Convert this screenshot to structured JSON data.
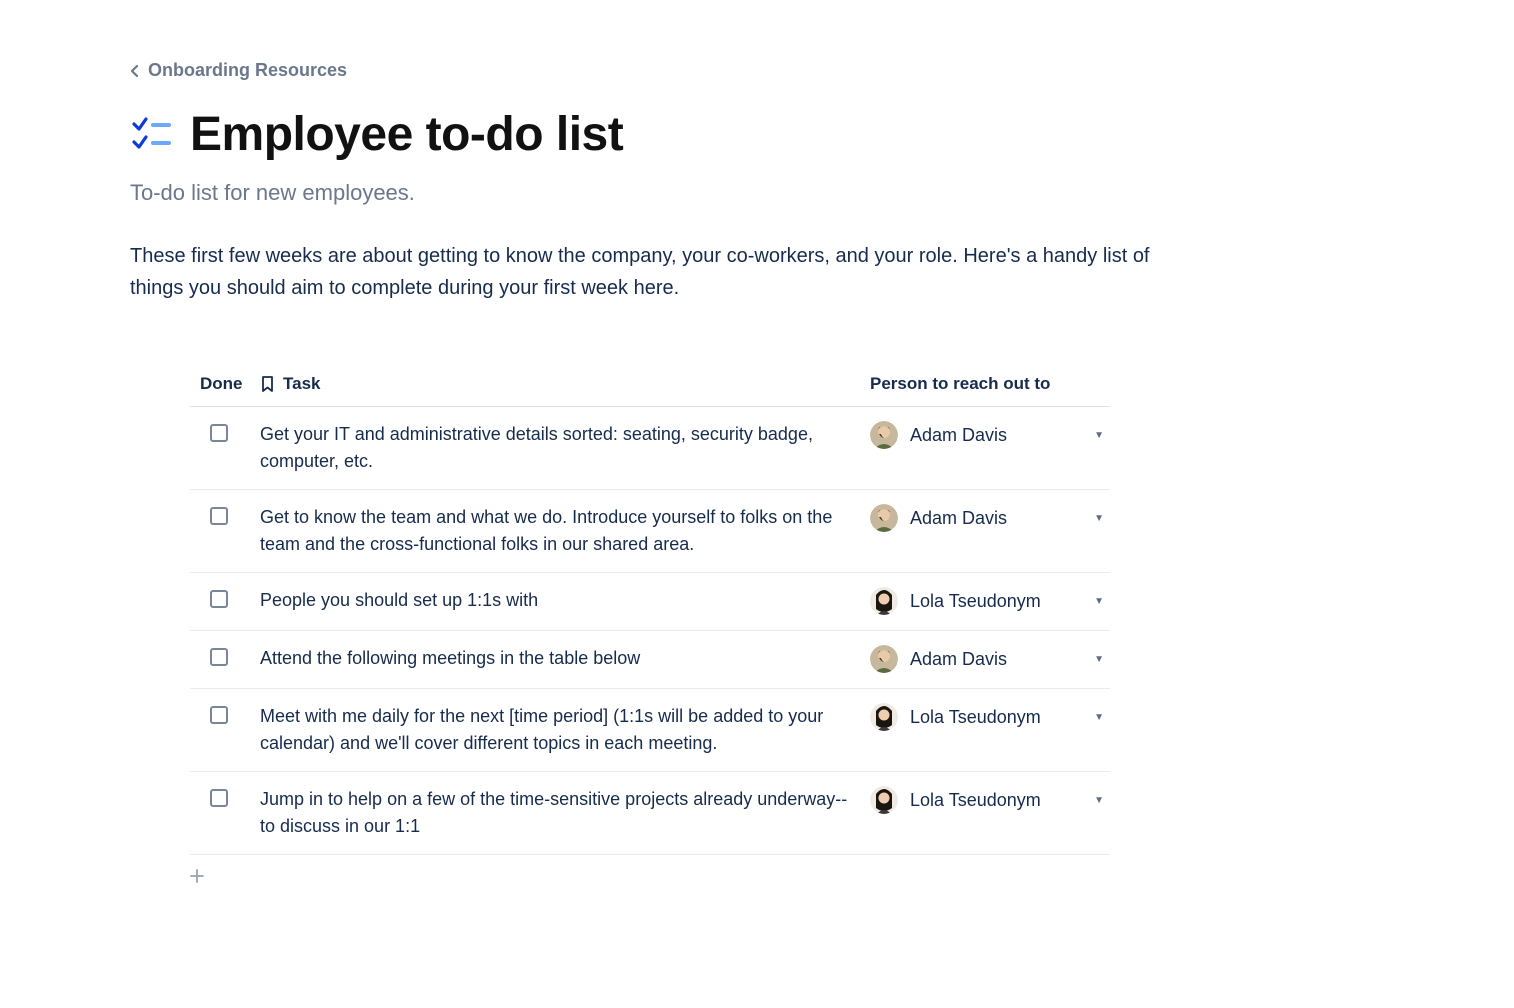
{
  "breadcrumb": {
    "label": "Onboarding Resources"
  },
  "title": "Employee to-do list",
  "subtitle": "To-do list for new employees.",
  "intro": "These first few weeks are about getting to know the company, your co-workers, and your role. Here's a handy list of things you should aim to complete during your first week here.",
  "table": {
    "headers": {
      "done": "Done",
      "task": "Task",
      "person": "Person to reach out to"
    },
    "rows": [
      {
        "done": false,
        "task": "Get your IT and administrative details sorted: seating, security badge, computer, etc.",
        "person": "Adam Davis",
        "avatar": "adam"
      },
      {
        "done": false,
        "task": "Get to know the team and what we do. Introduce yourself to folks on the team and the cross-functional folks in our shared area.",
        "person": "Adam Davis",
        "avatar": "adam"
      },
      {
        "done": false,
        "task": "People you should set up 1:1s with",
        "person": "Lola Tseudonym",
        "avatar": "lola"
      },
      {
        "done": false,
        "task": "Attend the following meetings in the table below",
        "person": "Adam Davis",
        "avatar": "adam"
      },
      {
        "done": false,
        "task": "Meet with me daily for the next [time period] (1:1s will be added to your calendar) and we'll cover different topics in each meeting.",
        "person": "Lola Tseudonym",
        "avatar": "lola"
      },
      {
        "done": false,
        "task": "Jump in to help on a few of the time-sensitive projects already underway--to discuss in our 1:1",
        "person": "Lola Tseudonym",
        "avatar": "lola"
      }
    ]
  }
}
